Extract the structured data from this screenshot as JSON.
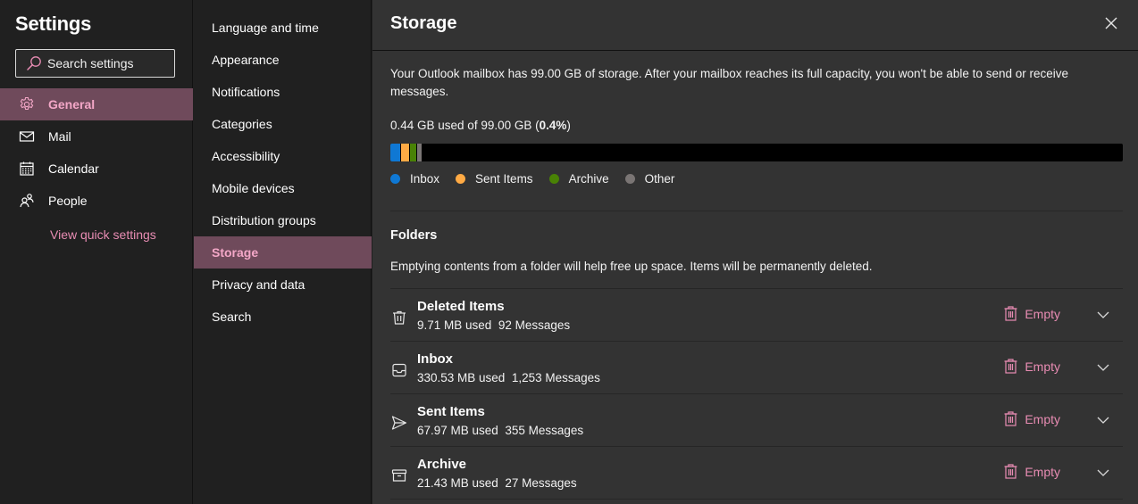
{
  "settings": {
    "title": "Settings",
    "search_placeholder": "Search settings",
    "nav": [
      {
        "label": "General",
        "icon": "gear-icon",
        "active": true
      },
      {
        "label": "Mail",
        "icon": "mail-icon",
        "active": false
      },
      {
        "label": "Calendar",
        "icon": "calendar-icon",
        "active": false
      },
      {
        "label": "People",
        "icon": "people-icon",
        "active": false
      }
    ],
    "quick_settings_link": "View quick settings"
  },
  "subnav": {
    "items": [
      {
        "label": "Language and time",
        "active": false
      },
      {
        "label": "Appearance",
        "active": false
      },
      {
        "label": "Notifications",
        "active": false
      },
      {
        "label": "Categories",
        "active": false
      },
      {
        "label": "Accessibility",
        "active": false
      },
      {
        "label": "Mobile devices",
        "active": false
      },
      {
        "label": "Distribution groups",
        "active": false
      },
      {
        "label": "Storage",
        "active": true
      },
      {
        "label": "Privacy and data",
        "active": false
      },
      {
        "label": "Search",
        "active": false
      }
    ]
  },
  "storage": {
    "title": "Storage",
    "description": "Your Outlook mailbox has 99.00 GB of storage. After your mailbox reaches its full capacity, you won't be able to send or receive messages.",
    "usage_prefix": "0.44 GB used of 99.00 GB (",
    "usage_percent": "0.4%",
    "usage_suffix": ")",
    "usage_fraction": 0.004,
    "segments": [
      {
        "name": "Inbox",
        "color": "#0f78d4",
        "fraction": 0.014
      },
      {
        "name": "Sent Items",
        "color": "#ffaa44",
        "fraction": 0.011
      },
      {
        "name": "Archive",
        "color": "#498205",
        "fraction": 0.009
      },
      {
        "name": "Other",
        "color": "#7a7574",
        "fraction": 0.006
      }
    ],
    "legend": [
      {
        "label": "Inbox",
        "color": "#0f78d4"
      },
      {
        "label": "Sent Items",
        "color": "#ffaa44"
      },
      {
        "label": "Archive",
        "color": "#498205"
      },
      {
        "label": "Other",
        "color": "#7a7574"
      }
    ],
    "folders_title": "Folders",
    "folders_description": "Emptying contents from a folder will help free up space. Items will be permanently deleted.",
    "empty_label": "Empty",
    "folders": [
      {
        "name": "Deleted Items",
        "icon": "trash-icon",
        "size": "9.71 MB used",
        "messages": "92 Messages"
      },
      {
        "name": "Inbox",
        "icon": "inbox-icon",
        "size": "330.53 MB used",
        "messages": "1,253 Messages"
      },
      {
        "name": "Sent Items",
        "icon": "send-icon",
        "size": "67.97 MB used",
        "messages": "355 Messages"
      },
      {
        "name": "Archive",
        "icon": "archive-icon",
        "size": "21.43 MB used",
        "messages": "27 Messages"
      }
    ]
  },
  "colors": {
    "accent": "#e88cb3",
    "active_bg": "#6f4a5b",
    "active_text": "#f3a7c7"
  }
}
